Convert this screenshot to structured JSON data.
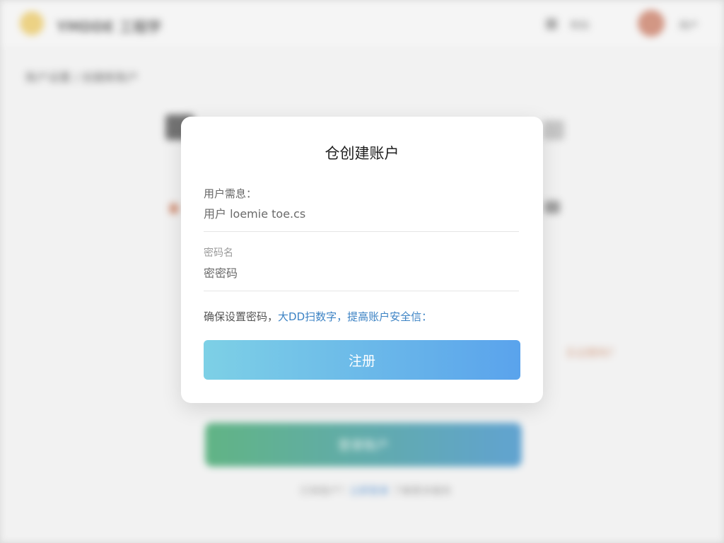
{
  "background": {
    "brand_name": "YMDDE  工程学",
    "nav_link": "帮助",
    "user_name": "用户",
    "breadcrumb": "账户设置 / 创建新账户",
    "right_link": "忘记密码？",
    "primary_button": "登录账户",
    "footer_prefix": "已有账户？",
    "footer_link": "立即登录",
    "footer_suffix": " 了解更多服务"
  },
  "modal": {
    "title": "仓创建账户",
    "username_label": "用户需息：",
    "username_placeholder": "用户 loemie toe.cs",
    "password_label": "密码名",
    "password_placeholder": "密密码",
    "hint_prefix": "确保设置密码，",
    "hint_accent_1": "大DD扫数字，",
    "hint_accent_2": "提高账户安全信：",
    "register_label": "注册"
  },
  "colors": {
    "accent": "#3b82c4",
    "button_gradient_start": "#7dd0e6",
    "button_gradient_end": "#5aa3ec"
  }
}
